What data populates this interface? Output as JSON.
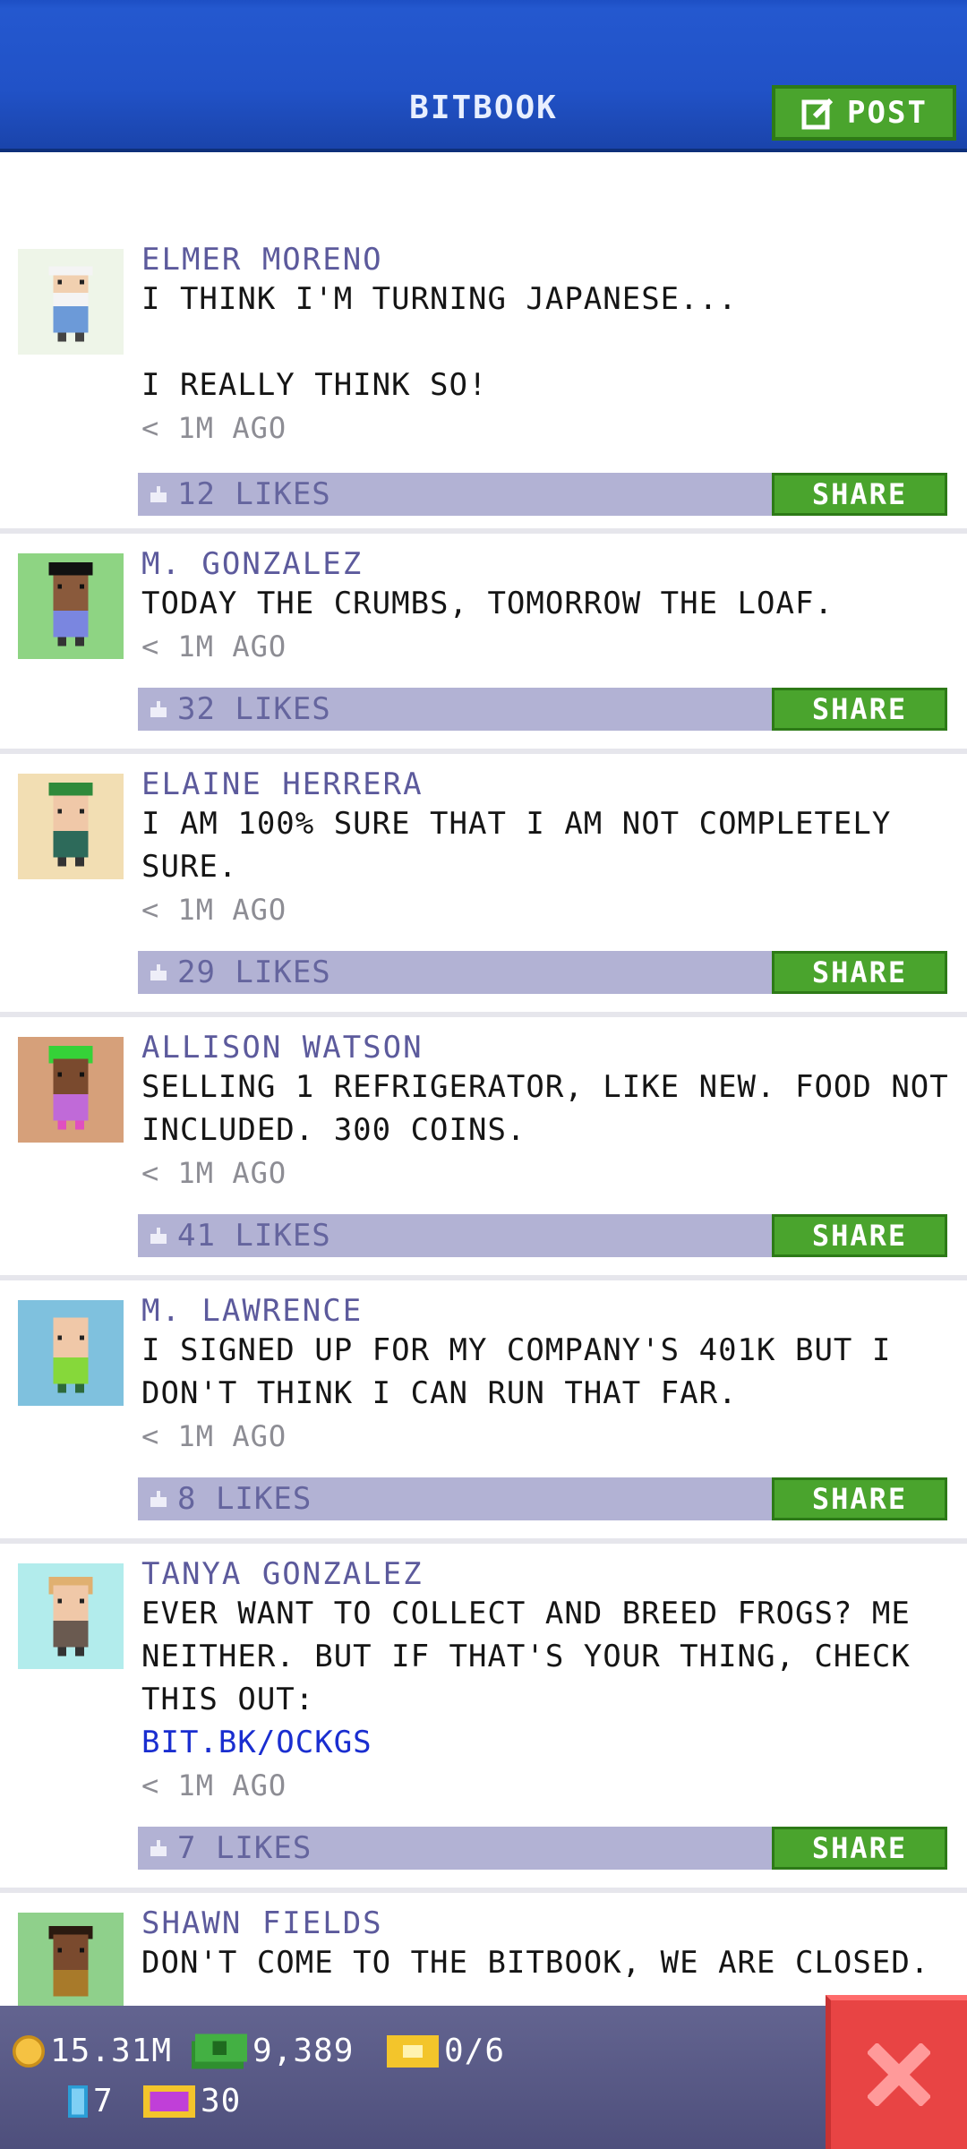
{
  "app": {
    "title": "BITBOOK",
    "post_label": "POST"
  },
  "posts": [
    {
      "author": "ELMER MORENO",
      "text": "I THINK I'M TURNING JAPANESE...\n\nI REALLY THINK SO!",
      "link": "",
      "time": "< 1M AGO",
      "likes": "12 LIKES",
      "share": "SHARE",
      "avatar_bg": "#eef5e8"
    },
    {
      "author": "M. GONZALEZ",
      "text": "TODAY THE CRUMBS, TOMORROW THE LOAF.",
      "link": "",
      "time": "< 1M AGO",
      "likes": "32 LIKES",
      "share": "SHARE",
      "avatar_bg": "#8ed483"
    },
    {
      "author": "ELAINE HERRERA",
      "text": "I AM 100% SURE THAT I AM NOT COMPLETELY SURE.",
      "link": "",
      "time": "< 1M AGO",
      "likes": "29 LIKES",
      "share": "SHARE",
      "avatar_bg": "#f2deb3"
    },
    {
      "author": "ALLISON WATSON",
      "text": "SELLING 1 REFRIGERATOR, LIKE NEW. FOOD NOT INCLUDED. 300 COINS.",
      "link": "",
      "time": "< 1M AGO",
      "likes": "41 LIKES",
      "share": "SHARE",
      "avatar_bg": "#d6a07a"
    },
    {
      "author": "M. LAWRENCE",
      "text": "I SIGNED UP FOR MY COMPANY'S 401K BUT I DON'T THINK I CAN RUN THAT FAR.",
      "link": "",
      "time": "< 1M AGO",
      "likes": "8 LIKES",
      "share": "SHARE",
      "avatar_bg": "#7fc1de"
    },
    {
      "author": "TANYA GONZALEZ",
      "text": "EVER WANT TO COLLECT AND BREED FROGS? ME NEITHER. BUT IF THAT'S YOUR THING, CHECK THIS OUT:",
      "link": "BIT.BK/OCKGS",
      "time": "< 1M AGO",
      "likes": "7 LIKES",
      "share": "SHARE",
      "avatar_bg": "#b2ecec"
    },
    {
      "author": "SHAWN FIELDS",
      "text": "DON'T COME TO THE BITBOOK, WE ARE CLOSED.",
      "link": "",
      "time": "",
      "likes": "",
      "share": "",
      "avatar_bg": "#8fd08b"
    }
  ],
  "status": {
    "coins": "15.31M",
    "bux": "9,389",
    "tickets": "0/6",
    "elevator": "7",
    "vip": "30"
  },
  "colors": {
    "header": "#2152c7",
    "share": "#4aa42d",
    "likes_bar": "#b2b2d4",
    "close": "#e84444"
  }
}
